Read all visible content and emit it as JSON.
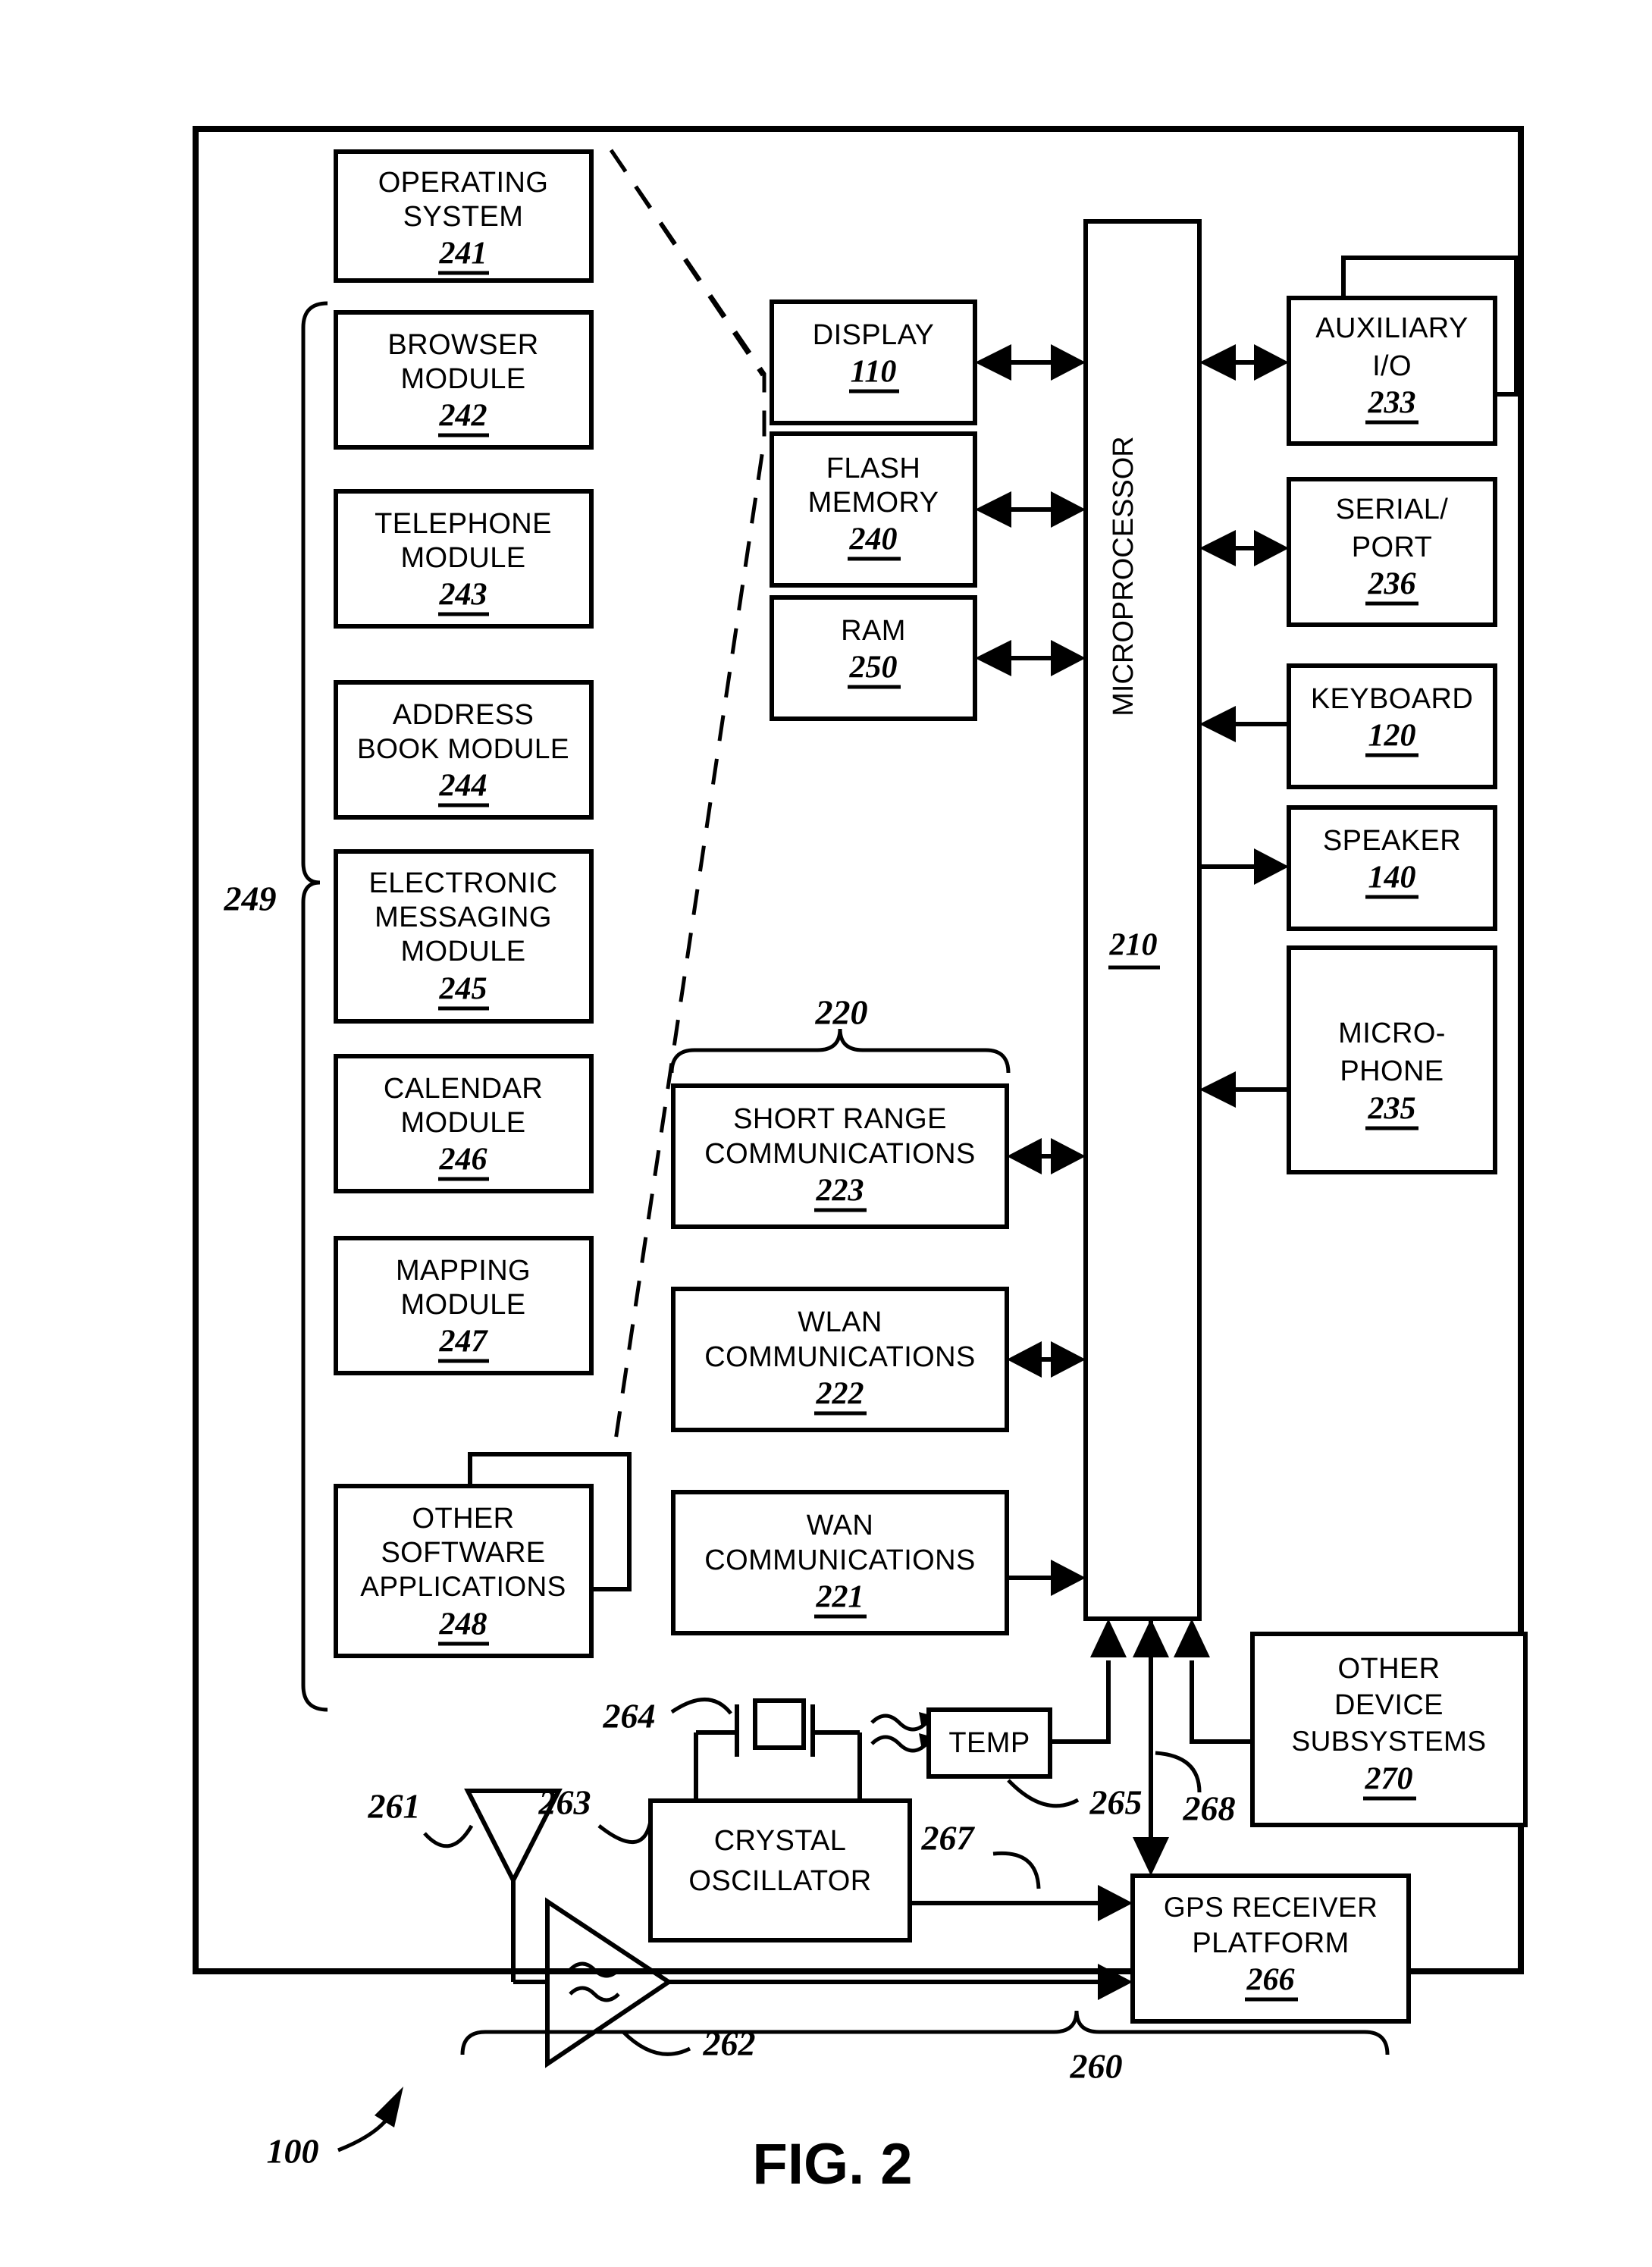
{
  "figure": {
    "label": "FIG. 2",
    "device_ref": "100",
    "outer_frame_ref": "100"
  },
  "software_group": {
    "brace_ref": "249",
    "operating_system": {
      "lines": [
        "OPERATING",
        "SYSTEM"
      ],
      "ref": "241"
    },
    "modules": [
      {
        "lines": [
          "BROWSER",
          "MODULE"
        ],
        "ref": "242"
      },
      {
        "lines": [
          "TELEPHONE",
          "MODULE"
        ],
        "ref": "243"
      },
      {
        "lines": [
          "ADDRESS",
          "BOOK MODULE"
        ],
        "ref": "244"
      },
      {
        "lines": [
          "ELECTRONIC",
          "MESSAGING",
          "MODULE"
        ],
        "ref": "245"
      },
      {
        "lines": [
          "CALENDAR",
          "MODULE"
        ],
        "ref": "246"
      },
      {
        "lines": [
          "MAPPING",
          "MODULE"
        ],
        "ref": "247"
      },
      {
        "lines": [
          "OTHER",
          "SOFTWARE",
          "APPLICATIONS"
        ],
        "ref": "248"
      }
    ]
  },
  "memory_column": [
    {
      "lines": [
        "DISPLAY"
      ],
      "ref": "110"
    },
    {
      "lines": [
        "FLASH",
        "MEMORY"
      ],
      "ref": "240"
    },
    {
      "lines": [
        "RAM"
      ],
      "ref": "250"
    }
  ],
  "communications_group": {
    "brace_ref": "220",
    "boxes": [
      {
        "lines": [
          "SHORT RANGE",
          "COMMUNICATIONS"
        ],
        "ref": "223"
      },
      {
        "lines": [
          "WLAN",
          "COMMUNICATIONS"
        ],
        "ref": "222"
      },
      {
        "lines": [
          "WAN",
          "COMMUNICATIONS"
        ],
        "ref": "221"
      }
    ]
  },
  "processor": {
    "label": "MICROPROCESSOR",
    "ref": "210"
  },
  "peripherals": [
    {
      "lines": [
        "AUXILIARY",
        "I/O"
      ],
      "ref": "233"
    },
    {
      "lines": [
        "SERIAL/",
        "PORT"
      ],
      "ref": "236"
    },
    {
      "lines": [
        "KEYBOARD"
      ],
      "ref": "120"
    },
    {
      "lines": [
        "SPEAKER"
      ],
      "ref": "140"
    },
    {
      "lines": [
        "MICRO-",
        "PHONE"
      ],
      "ref": "235"
    }
  ],
  "other_subsystems": {
    "lines": [
      "OTHER",
      "DEVICE",
      "SUBSYSTEMS"
    ],
    "ref": "270"
  },
  "gps_section": {
    "group_ref": "260",
    "antenna_ref": "261",
    "amplifier_ref": "262",
    "oscillator": {
      "lines": [
        "CRYSTAL",
        "OSCILLATOR"
      ],
      "ref": "263"
    },
    "crystal_ref": "264",
    "temp_sensor": {
      "label": "TEMP",
      "ref": "265"
    },
    "clock_line_ref": "267",
    "control_line_ref": "268",
    "receiver": {
      "lines": [
        "GPS RECEIVER",
        "PLATFORM"
      ],
      "ref": "266"
    }
  }
}
